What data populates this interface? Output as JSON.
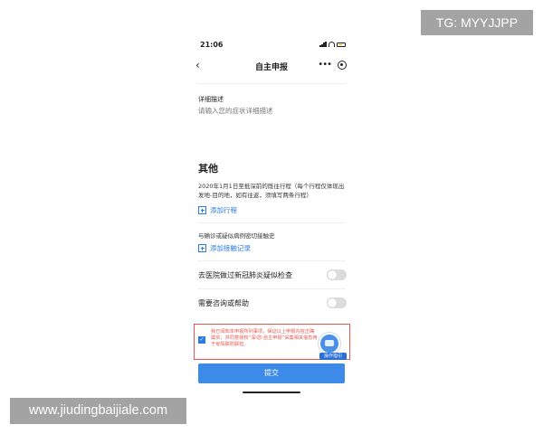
{
  "status_bar": {
    "time": "21:06"
  },
  "nav": {
    "back_label": "‹",
    "title": "自主申报",
    "more_label": "•••"
  },
  "form": {
    "detail_label": "详细描述",
    "detail_placeholder": "请输入您的症状详细描述"
  },
  "other": {
    "section_title": "其他",
    "trip_description": "2020年1月1日至抵深前的既往行程（每个行程仅体现出发地-目的地，如有往返，须填写两条行程）",
    "add_trip_label": "添加行程",
    "contact_label": "与确诊或疑似病例密切接触史",
    "add_contact_label": "添加接触记录",
    "toggles": [
      {
        "label": "去医院做过新冠肺炎疑似检查",
        "on": false
      },
      {
        "label": "需要咨询或帮助",
        "on": false
      }
    ]
  },
  "consent": {
    "checked": true,
    "check_mark": "✓",
    "text": "我已阅知本申报所列事项，保证以上申报内容正确属实，并同意授权“深i您-自主申报”采集相关信息用于疫情联防联控。",
    "mascot_tag": "操作指引"
  },
  "submit_label": "提交",
  "watermarks": {
    "tg": "TG: MYYJJPP",
    "site": "www.jiudingbaijiale.com"
  },
  "colors": {
    "accent": "#3d8ae8",
    "link": "#2a7be4",
    "warning": "#e8564e",
    "watermark_bg": "#a3a3a3"
  }
}
